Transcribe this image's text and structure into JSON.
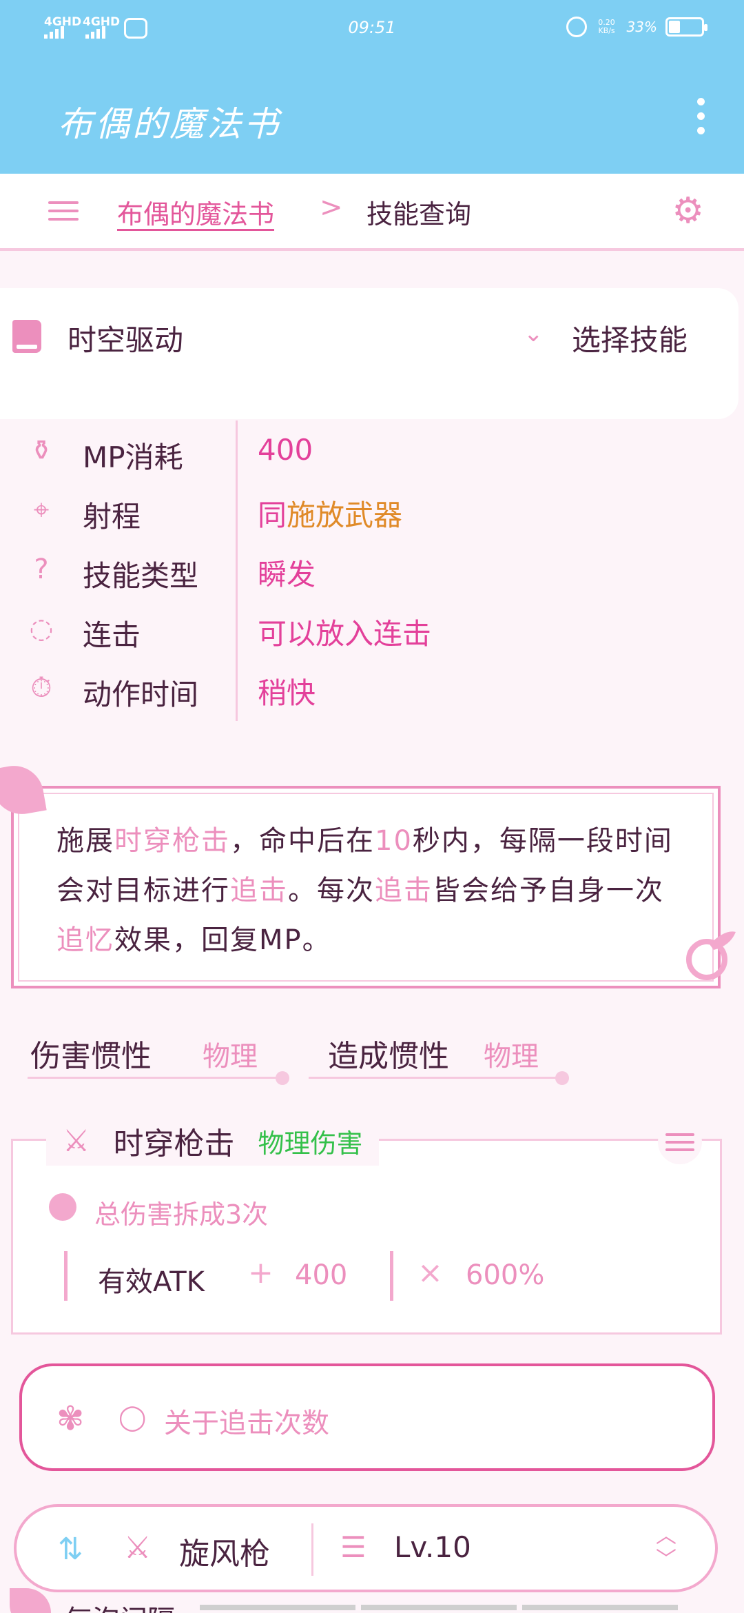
{
  "status_bar": {
    "signal_1": "4GHD",
    "signal_2": "4GHD",
    "time": "09:51",
    "net_speed": "0.20 KB/s",
    "battery": "33%"
  },
  "app_bar": {
    "title": "布偶的魔法书"
  },
  "breadcrumb": {
    "root": "布偶的魔法书",
    "separator": ">",
    "current": "技能查询"
  },
  "skill_selector": {
    "selected": "时空驱动",
    "button": "选择技能"
  },
  "properties": [
    {
      "label": "MP消耗",
      "value": "400",
      "icon": "potion-icon"
    },
    {
      "label": "射程",
      "value_a": "同",
      "value_b": "施放武器",
      "icon": "target-icon"
    },
    {
      "label": "技能类型",
      "value": "瞬发",
      "icon": "question-icon"
    },
    {
      "label": "连击",
      "value": "可以放入连击",
      "icon": "combo-icon"
    },
    {
      "label": "动作时间",
      "value": "稍快",
      "icon": "timer-icon"
    }
  ],
  "description": {
    "p1": "施展",
    "h1": "时穿枪击",
    "p2": "，命中后在",
    "h2": "10",
    "p3": "秒内，每隔一段时间会对目标进行",
    "h3": "追击",
    "p4": "。每次",
    "h4": "追击",
    "p5": "皆会给予自身一次",
    "h5": "追忆",
    "p6": "效果，回复MP。"
  },
  "inertia": {
    "damage_label": "伤害惯性",
    "damage_value": "物理",
    "cause_label": "造成惯性",
    "cause_value": "物理"
  },
  "damage": {
    "name": "时穿枪击",
    "type": "物理伤害",
    "split": "总伤害拆成3次",
    "atk_label": "有效ATK",
    "plus": "+",
    "base": "400",
    "times": "×",
    "multiplier": "600%"
  },
  "note": {
    "text": "关于追击次数"
  },
  "skill_bar": {
    "skill": "旋风枪",
    "level": "Lv.10"
  },
  "next_section": {
    "title": "气泡间隔"
  },
  "colors": {
    "app_bar": "#7ecff3",
    "accent_pink": "#ec8fbd",
    "value_pink": "#e3409a",
    "orange": "#e08a28",
    "green": "#34c04a"
  }
}
